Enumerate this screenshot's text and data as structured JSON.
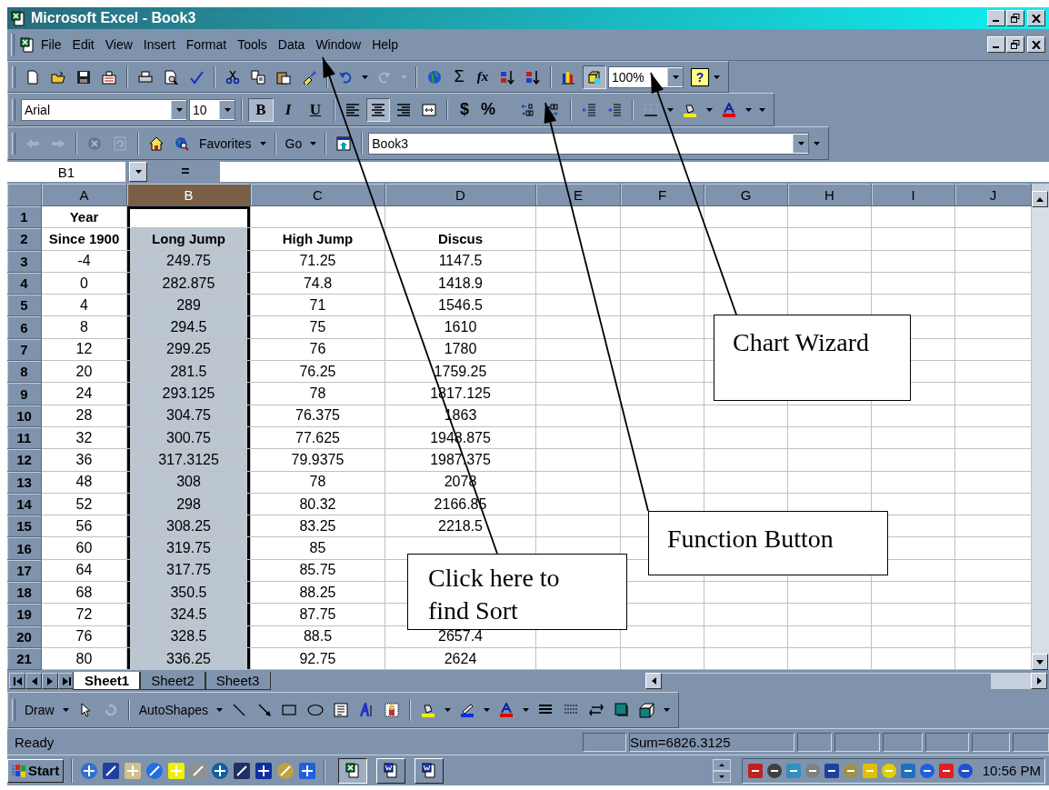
{
  "window": {
    "title": "Microsoft Excel - Book3"
  },
  "menu": [
    "File",
    "Edit",
    "View",
    "Insert",
    "Format",
    "Tools",
    "Data",
    "Window",
    "Help"
  ],
  "standard_toolbar": {
    "autosum": "Σ",
    "function": "fx",
    "drawing_pressed": true,
    "zoom": "100%",
    "help": "?"
  },
  "formatting_toolbar": {
    "font": "Arial",
    "size": "10",
    "styles": [
      {
        "kind": "bold",
        "label": "B",
        "pressed": true
      },
      {
        "kind": "italic",
        "label": "I",
        "pressed": false
      },
      {
        "kind": "underline",
        "label": "U",
        "pressed": false
      }
    ],
    "align": [
      {
        "kind": "left",
        "selected": false
      },
      {
        "kind": "center",
        "selected": true
      },
      {
        "kind": "right",
        "selected": false
      }
    ],
    "currency": "$",
    "percent": "%"
  },
  "web_toolbar": {
    "favorites": "Favorites",
    "go": "Go",
    "address": "Book3"
  },
  "formula_bar": {
    "name_box": "B1",
    "equals": "="
  },
  "sheet": {
    "columns": [
      {
        "label": "A",
        "selected": false
      },
      {
        "label": "B",
        "selected": true
      },
      {
        "label": "C",
        "selected": false
      },
      {
        "label": "D",
        "selected": false
      },
      {
        "label": "E",
        "selected": false
      },
      {
        "label": "F",
        "selected": false
      },
      {
        "label": "G",
        "selected": false
      },
      {
        "label": "H",
        "selected": false
      },
      {
        "label": "I",
        "selected": false
      },
      {
        "label": "J",
        "selected": false
      }
    ],
    "rows": [
      {
        "header": "1",
        "bold": true,
        "cells": [
          "Year",
          null,
          null,
          null
        ]
      },
      {
        "header": "2",
        "bold": true,
        "cells": [
          "Since 1900",
          "Long Jump",
          "High Jump",
          "Discus"
        ]
      },
      {
        "header": "3",
        "bold": false,
        "cells": [
          "-4",
          "249.75",
          "71.25",
          "1147.5"
        ]
      },
      {
        "header": "4",
        "bold": false,
        "cells": [
          "0",
          "282.875",
          "74.8",
          "1418.9"
        ]
      },
      {
        "header": "5",
        "bold": false,
        "cells": [
          "4",
          "289",
          "71",
          "1546.5"
        ]
      },
      {
        "header": "6",
        "bold": false,
        "cells": [
          "8",
          "294.5",
          "75",
          "1610"
        ]
      },
      {
        "header": "7",
        "bold": false,
        "cells": [
          "12",
          "299.25",
          "76",
          "1780"
        ]
      },
      {
        "header": "8",
        "bold": false,
        "cells": [
          "20",
          "281.5",
          "76.25",
          "1759.25"
        ]
      },
      {
        "header": "9",
        "bold": false,
        "cells": [
          "24",
          "293.125",
          "78",
          "1817.125"
        ]
      },
      {
        "header": "10",
        "bold": false,
        "cells": [
          "28",
          "304.75",
          "76.375",
          "1863"
        ]
      },
      {
        "header": "11",
        "bold": false,
        "cells": [
          "32",
          "300.75",
          "77.625",
          "1948.875"
        ]
      },
      {
        "header": "12",
        "bold": false,
        "cells": [
          "36",
          "317.3125",
          "79.9375",
          "1987.375"
        ]
      },
      {
        "header": "13",
        "bold": false,
        "cells": [
          "48",
          "308",
          "78",
          "2078"
        ]
      },
      {
        "header": "14",
        "bold": false,
        "cells": [
          "52",
          "298",
          "80.32",
          "2166.85"
        ]
      },
      {
        "header": "15",
        "bold": false,
        "cells": [
          "56",
          "308.25",
          "83.25",
          "2218.5"
        ]
      },
      {
        "header": "16",
        "bold": false,
        "cells": [
          "60",
          "319.75",
          "85",
          null
        ]
      },
      {
        "header": "17",
        "bold": false,
        "cells": [
          "64",
          "317.75",
          "85.75",
          null
        ]
      },
      {
        "header": "18",
        "bold": false,
        "cells": [
          "68",
          "350.5",
          "88.25",
          null
        ]
      },
      {
        "header": "19",
        "bold": false,
        "cells": [
          "72",
          "324.5",
          "87.75",
          null
        ]
      },
      {
        "header": "20",
        "bold": false,
        "cells": [
          "76",
          "328.5",
          "88.5",
          "2657.4"
        ]
      },
      {
        "header": "21",
        "bold": false,
        "cells": [
          "80",
          "336.25",
          "92.75",
          "2624"
        ]
      }
    ]
  },
  "sheet_tabs": [
    {
      "label": "Sheet1",
      "selected": true
    },
    {
      "label": "Sheet2",
      "selected": false
    },
    {
      "label": "Sheet3",
      "selected": false
    }
  ],
  "drawing_toolbar": {
    "draw": "Draw",
    "autoshapes": "AutoShapes"
  },
  "status_bar": {
    "mode": "Ready",
    "sum": "Sum=6826.3125"
  },
  "taskbar": {
    "start": "Start",
    "clock": "10:56 PM"
  },
  "callouts": [
    {
      "text": "Chart Wizard"
    },
    {
      "text": "Function Button"
    },
    {
      "text": "Click here to find Sort"
    }
  ]
}
